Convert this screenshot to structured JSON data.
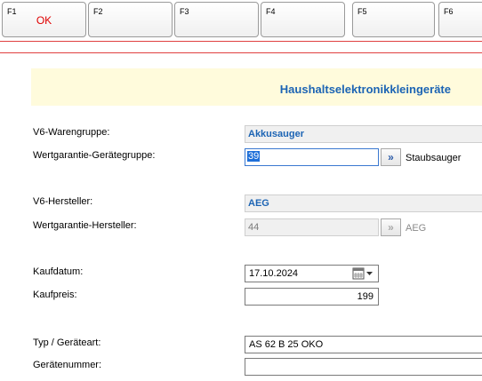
{
  "fkeys": [
    {
      "key": "F1",
      "label": "OK"
    },
    {
      "key": "F2",
      "label": ""
    },
    {
      "key": "F3",
      "label": ""
    },
    {
      "key": "F4",
      "label": ""
    },
    {
      "key": "F5",
      "label": ""
    },
    {
      "key": "F6",
      "label": ""
    }
  ],
  "section_title": "Haushaltselektronikkleingeräte",
  "form": {
    "warengruppe_label": "V6-Warengruppe:",
    "warengruppe_value": "Akkusauger",
    "geraetegruppe_label": "Wertgarantie-Gerätegruppe:",
    "geraetegruppe_value": "39",
    "geraetegruppe_name": "Staubsauger",
    "hersteller_label": "V6-Hersteller:",
    "hersteller_value": "AEG",
    "wg_hersteller_label": "Wertgarantie-Hersteller:",
    "wg_hersteller_value": "44",
    "wg_hersteller_name": "AEG",
    "kaufdatum_label": "Kaufdatum:",
    "kaufdatum_value": "17.10.2024",
    "kaufpreis_label": "Kaufpreis:",
    "kaufpreis_value": "199",
    "typ_label": "Typ / Geräteart:",
    "typ_value": "AS 62 B 25 OKO",
    "geraetenummer_label": "Gerätenummer:",
    "geraetenummer_value": ""
  },
  "icons": {
    "lookup": "double-chevron-right-icon",
    "calendar": "calendar-icon",
    "dropdown": "chevron-down-icon"
  },
  "colors": {
    "accent_blue": "#1c64b4",
    "fkey_label_red": "#e00000",
    "title_band": "#fffbdc",
    "selection": "#1e6fd9"
  }
}
